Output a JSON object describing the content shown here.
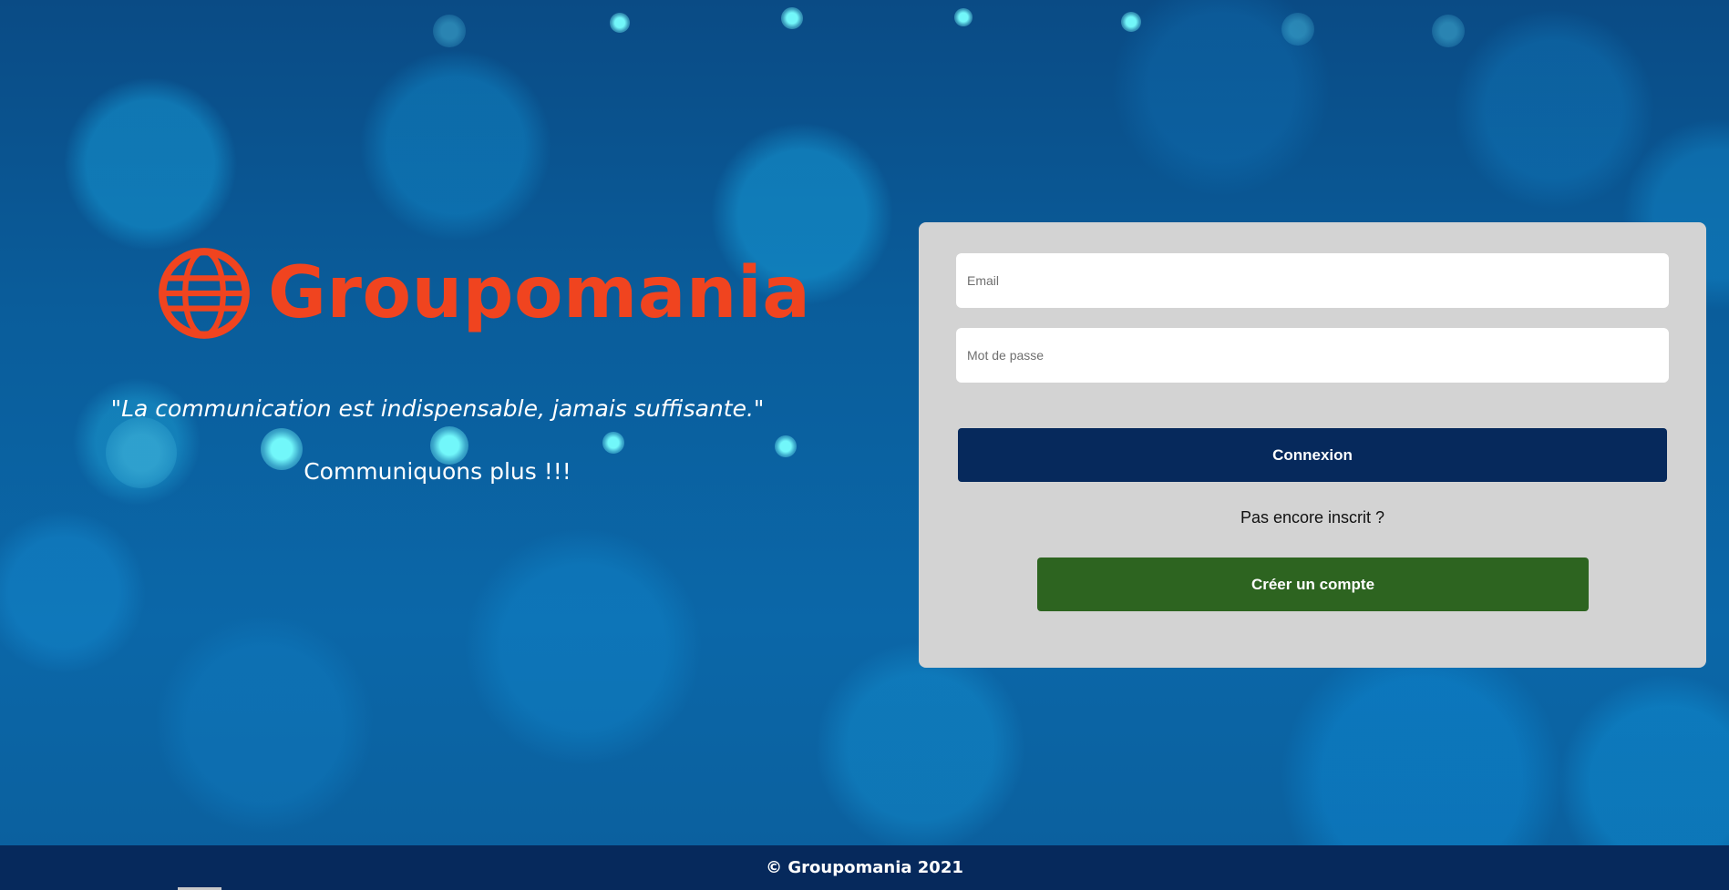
{
  "brand": {
    "name": "Groupomania",
    "logo_icon": "globe-icon",
    "color": "#f0441f"
  },
  "hero": {
    "motto": "\"La communication est indispensable, jamais suffisante.\"",
    "slogan": "Communiquons plus !!!"
  },
  "login_form": {
    "email": {
      "placeholder": "Email",
      "value": ""
    },
    "password": {
      "placeholder": "Mot de passe",
      "value": ""
    },
    "login_button": "Connexion",
    "signup_prompt": "Pas encore inscrit ?",
    "signup_button": "Créer un compte"
  },
  "footer": {
    "text": "© Groupomania 2021"
  },
  "colors": {
    "navy": "#06295c",
    "green": "#2d6420",
    "card": "#d3d3d3",
    "brand_red": "#f0441f"
  }
}
